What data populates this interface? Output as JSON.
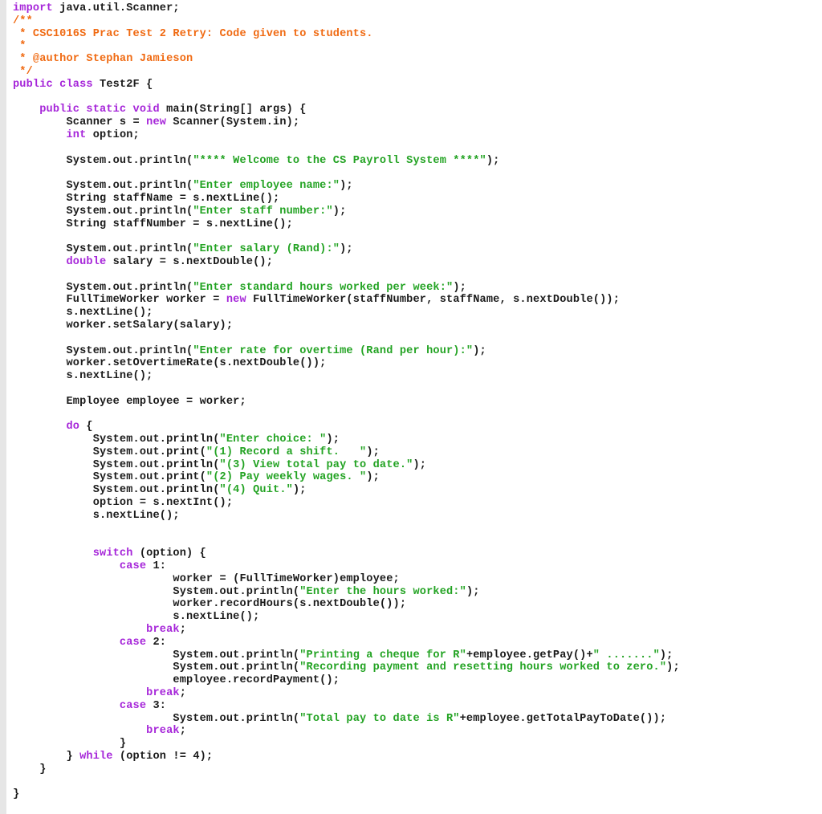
{
  "editor": {
    "language": "java",
    "colors": {
      "keyword": "#a626d9",
      "string": "#23a323",
      "comment": "#f06a12",
      "plain": "#1a1a1a",
      "gutter": "#e6e6e6"
    },
    "lines": [
      [
        [
          "kw",
          "import"
        ],
        [
          "pl",
          " java.util.Scanner;"
        ]
      ],
      [
        [
          "cm",
          "/**"
        ]
      ],
      [
        [
          "cm",
          " * CSC1016S Prac Test 2 Retry: Code given to students."
        ]
      ],
      [
        [
          "cm",
          " *"
        ]
      ],
      [
        [
          "cm",
          " * @author Stephan Jamieson"
        ]
      ],
      [
        [
          "cm",
          " */"
        ]
      ],
      [
        [
          "kw",
          "public class"
        ],
        [
          "pl",
          " Test2F {"
        ]
      ],
      [],
      [
        [
          "pl",
          "    "
        ],
        [
          "kw",
          "public static void"
        ],
        [
          "pl",
          " main(String[] args) {"
        ]
      ],
      [
        [
          "pl",
          "        Scanner s = "
        ],
        [
          "kw",
          "new"
        ],
        [
          "pl",
          " Scanner(System.in);"
        ]
      ],
      [
        [
          "pl",
          "        "
        ],
        [
          "kw",
          "int"
        ],
        [
          "pl",
          " option;"
        ]
      ],
      [],
      [
        [
          "pl",
          "        System.out.println("
        ],
        [
          "str",
          "\"**** Welcome to the CS Payroll System ****\""
        ],
        [
          "pl",
          ");"
        ]
      ],
      [],
      [
        [
          "pl",
          "        System.out.println("
        ],
        [
          "str",
          "\"Enter employee name:\""
        ],
        [
          "pl",
          ");"
        ]
      ],
      [
        [
          "pl",
          "        String staffName = s.nextLine();"
        ]
      ],
      [
        [
          "pl",
          "        System.out.println("
        ],
        [
          "str",
          "\"Enter staff number:\""
        ],
        [
          "pl",
          ");"
        ]
      ],
      [
        [
          "pl",
          "        String staffNumber = s.nextLine();"
        ]
      ],
      [],
      [
        [
          "pl",
          "        System.out.println("
        ],
        [
          "str",
          "\"Enter salary (Rand):\""
        ],
        [
          "pl",
          ");"
        ]
      ],
      [
        [
          "pl",
          "        "
        ],
        [
          "kw",
          "double"
        ],
        [
          "pl",
          " salary = s.nextDouble();"
        ]
      ],
      [],
      [
        [
          "pl",
          "        System.out.println("
        ],
        [
          "str",
          "\"Enter standard hours worked per week:\""
        ],
        [
          "pl",
          ");"
        ]
      ],
      [
        [
          "pl",
          "        FullTimeWorker worker = "
        ],
        [
          "kw",
          "new"
        ],
        [
          "pl",
          " FullTimeWorker(staffNumber, staffName, s.nextDouble());"
        ]
      ],
      [
        [
          "pl",
          "        s.nextLine();"
        ]
      ],
      [
        [
          "pl",
          "        worker.setSalary(salary);"
        ]
      ],
      [],
      [
        [
          "pl",
          "        System.out.println("
        ],
        [
          "str",
          "\"Enter rate for overtime (Rand per hour):\""
        ],
        [
          "pl",
          ");"
        ]
      ],
      [
        [
          "pl",
          "        worker.setOvertimeRate(s.nextDouble());"
        ]
      ],
      [
        [
          "pl",
          "        s.nextLine();"
        ]
      ],
      [],
      [
        [
          "pl",
          "        Employee employee = worker;"
        ]
      ],
      [],
      [
        [
          "pl",
          "        "
        ],
        [
          "kw",
          "do"
        ],
        [
          "pl",
          " {"
        ]
      ],
      [
        [
          "pl",
          "            System.out.println("
        ],
        [
          "str",
          "\"Enter choice: \""
        ],
        [
          "pl",
          ");"
        ]
      ],
      [
        [
          "pl",
          "            System.out.print("
        ],
        [
          "str",
          "\"(1) Record a shift.   \""
        ],
        [
          "pl",
          ");"
        ]
      ],
      [
        [
          "pl",
          "            System.out.println("
        ],
        [
          "str",
          "\"(3) View total pay to date.\""
        ],
        [
          "pl",
          ");"
        ]
      ],
      [
        [
          "pl",
          "            System.out.print("
        ],
        [
          "str",
          "\"(2) Pay weekly wages. \""
        ],
        [
          "pl",
          ");"
        ]
      ],
      [
        [
          "pl",
          "            System.out.println("
        ],
        [
          "str",
          "\"(4) Quit.\""
        ],
        [
          "pl",
          ");"
        ]
      ],
      [
        [
          "pl",
          "            option = s.nextInt();"
        ]
      ],
      [
        [
          "pl",
          "            s.nextLine();"
        ]
      ],
      [],
      [],
      [
        [
          "pl",
          "            "
        ],
        [
          "kw",
          "switch"
        ],
        [
          "pl",
          " (option) {"
        ]
      ],
      [
        [
          "pl",
          "                "
        ],
        [
          "kw",
          "case"
        ],
        [
          "pl",
          " 1:"
        ]
      ],
      [
        [
          "pl",
          "                        worker = (FullTimeWorker)employee;"
        ]
      ],
      [
        [
          "pl",
          "                        System.out.println("
        ],
        [
          "str",
          "\"Enter the hours worked:\""
        ],
        [
          "pl",
          ");"
        ]
      ],
      [
        [
          "pl",
          "                        worker.recordHours(s.nextDouble());"
        ]
      ],
      [
        [
          "pl",
          "                        s.nextLine();"
        ]
      ],
      [
        [
          "pl",
          "                    "
        ],
        [
          "kw",
          "break"
        ],
        [
          "pl",
          ";"
        ]
      ],
      [
        [
          "pl",
          "                "
        ],
        [
          "kw",
          "case"
        ],
        [
          "pl",
          " 2:"
        ]
      ],
      [
        [
          "pl",
          "                        System.out.println("
        ],
        [
          "str",
          "\"Printing a cheque for R\""
        ],
        [
          "pl",
          "+employee.getPay()+"
        ],
        [
          "str",
          "\" .......\""
        ],
        [
          "pl",
          ");"
        ]
      ],
      [
        [
          "pl",
          "                        System.out.println("
        ],
        [
          "str",
          "\"Recording payment and resetting hours worked to zero.\""
        ],
        [
          "pl",
          ");"
        ]
      ],
      [
        [
          "pl",
          "                        employee.recordPayment();"
        ]
      ],
      [
        [
          "pl",
          "                    "
        ],
        [
          "kw",
          "break"
        ],
        [
          "pl",
          ";"
        ]
      ],
      [
        [
          "pl",
          "                "
        ],
        [
          "kw",
          "case"
        ],
        [
          "pl",
          " 3:"
        ]
      ],
      [
        [
          "pl",
          "                        System.out.println("
        ],
        [
          "str",
          "\"Total pay to date is R\""
        ],
        [
          "pl",
          "+employee.getTotalPayToDate());"
        ]
      ],
      [
        [
          "pl",
          "                    "
        ],
        [
          "kw",
          "break"
        ],
        [
          "pl",
          ";"
        ]
      ],
      [
        [
          "pl",
          "                }"
        ]
      ],
      [
        [
          "pl",
          "        } "
        ],
        [
          "kw",
          "while"
        ],
        [
          "pl",
          " (option != 4);"
        ]
      ],
      [
        [
          "pl",
          "    }"
        ]
      ],
      [],
      [
        [
          "pl",
          "}"
        ]
      ]
    ]
  }
}
